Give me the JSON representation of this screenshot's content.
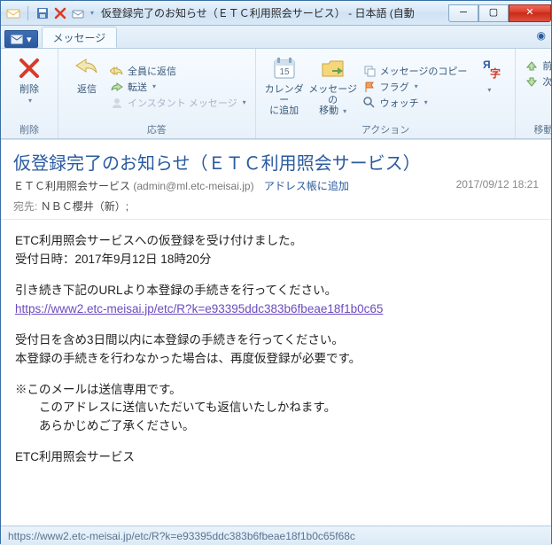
{
  "window": {
    "title": "仮登録完了のお知らせ（ＥＴＣ利用照会サービス） - 日本語 (自動"
  },
  "tabs": {
    "message": "メッセージ"
  },
  "ribbon": {
    "delete_group": "削除",
    "delete": "削除",
    "respond_group": "応答",
    "reply": "返信",
    "reply_all": "全員に返信",
    "forward": "転送",
    "instant_msg": "インスタント メッセージ",
    "actions_group": "アクション",
    "calendar": "カレンダー\nに追加",
    "move": "メッセージの\n移動",
    "copy": "メッセージのコピー",
    "flag": "フラグ",
    "watch": "ウォッチ",
    "encoding": "エンコード",
    "nav_group": "移動",
    "prev": "前へ",
    "next": "次へ"
  },
  "message": {
    "subject": "仮登録完了のお知らせ（ＥＴＣ利用照会サービス）",
    "from_name": "ＥＴＣ利用照会サービス",
    "from_addr": "(admin@ml.etc-meisai.jp)",
    "add_to_book": "アドレス帳に追加",
    "date": "2017/09/12 18:21",
    "to_label": "宛先:",
    "to_value": "ＮＢＣ櫻井（新）;"
  },
  "body": {
    "p1a": "ETC利用照会サービスへの仮登録を受け付けました。",
    "p1b": "受付日時：2017年9月12日 18時20分",
    "p2": "引き続き下記のURLより本登録の手続きを行ってください。",
    "link": "https://www2.etc-meisai.jp/etc/R?k=e93395ddc383b6fbeae18f1b0c65",
    "p3a": "受付日を含め3日間以内に本登録の手続きを行ってください。",
    "p3b": "本登録の手続きを行わなかった場合は、再度仮登録が必要です。",
    "p4a": "※このメールは送信専用です。",
    "p4b": "このアドレスに送信いただいても返信いたしかねます。",
    "p4c": "あらかじめご了承ください。",
    "p5": "ETC利用照会サービス"
  },
  "status": "https://www2.etc-meisai.jp/etc/R?k=e93395ddc383b6fbeae18f1b0c65f68c"
}
